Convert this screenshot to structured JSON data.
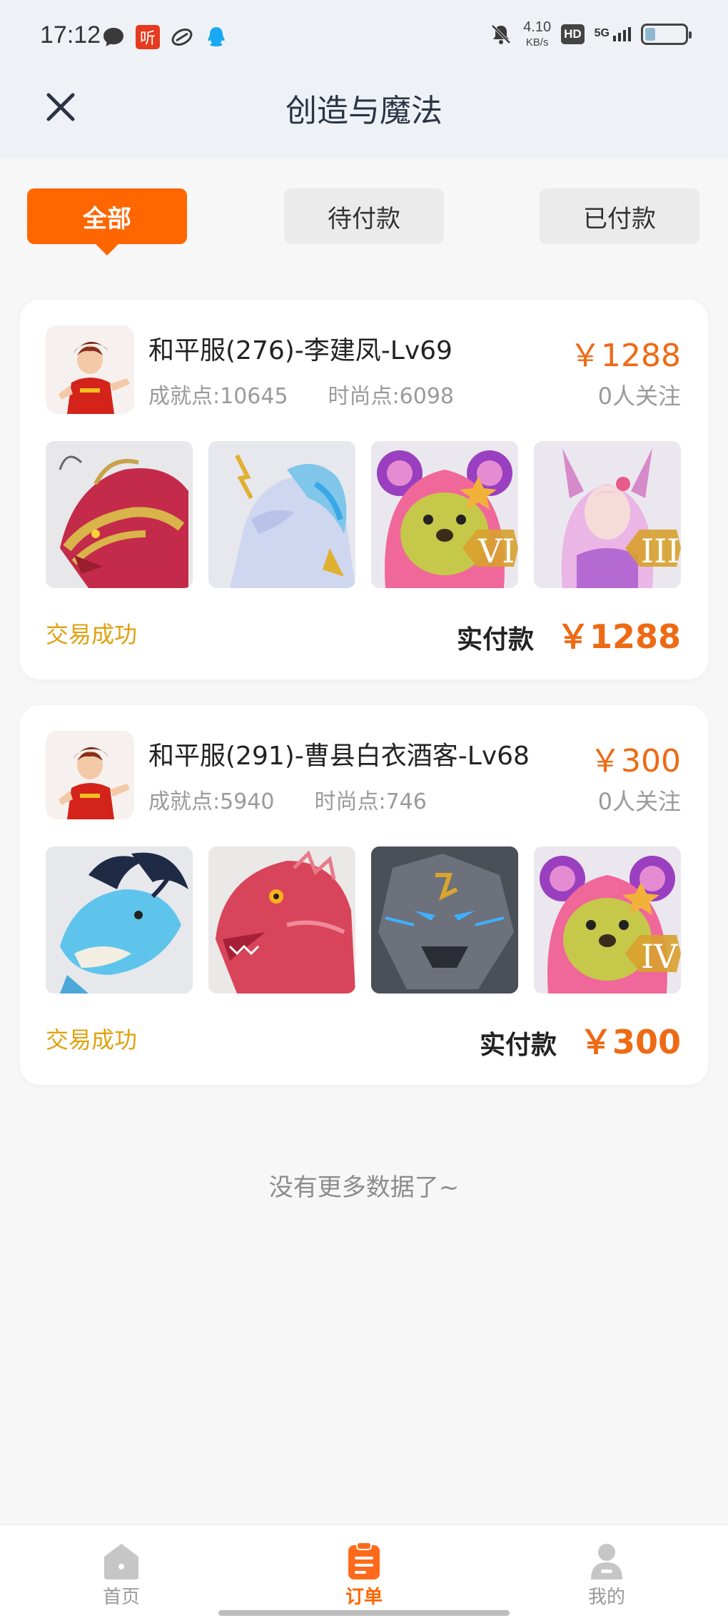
{
  "status_bar": {
    "time": "17:12",
    "ting_label": "听",
    "net_speed_value": "4.10",
    "net_speed_unit": "KB/s",
    "hd_label": "HD",
    "network_label": "5G",
    "battery_level": 0.25,
    "icons": [
      "message-icon",
      "ting-app-icon",
      "link-app-icon",
      "qq-icon",
      "mute-bell-icon",
      "hd-icon",
      "signal-icon",
      "battery-icon"
    ]
  },
  "header": {
    "title": "创造与魔法",
    "close_icon": "close-icon"
  },
  "tabs": [
    {
      "label": "全部",
      "active": true
    },
    {
      "label": "待付款",
      "active": false
    },
    {
      "label": "已付款",
      "active": false
    }
  ],
  "orders": [
    {
      "name": "和平服(276)-李建凤-Lv69",
      "achievement": "成就点:10645",
      "fashion": "时尚点:6098",
      "price": "￥1288",
      "followers": "0人关注",
      "items": [
        {
          "name": "red-golden-dragon-image",
          "badge": ""
        },
        {
          "name": "ice-blue-horse-image",
          "badge": ""
        },
        {
          "name": "pink-bear-image",
          "badge": "VI"
        },
        {
          "name": "fox-fairy-image",
          "badge": "III"
        }
      ],
      "status": "交易成功",
      "paid_label": "实付款",
      "paid_amount": "￥1288"
    },
    {
      "name": "和平服(291)-曹县白衣酒客-Lv68",
      "achievement": "成就点:5940",
      "fashion": "时尚点:746",
      "price": "￥300",
      "followers": "0人关注",
      "items": [
        {
          "name": "blue-dragon-image",
          "badge": ""
        },
        {
          "name": "red-scaled-dragon-image",
          "badge": ""
        },
        {
          "name": "stone-golem-image",
          "badge": ""
        },
        {
          "name": "pink-bear-image",
          "badge": "IV"
        }
      ],
      "status": "交易成功",
      "paid_label": "实付款",
      "paid_amount": "￥300"
    }
  ],
  "footer_note": "没有更多数据了~",
  "bottom_nav": [
    {
      "label": "首页",
      "icon": "home-icon",
      "active": false
    },
    {
      "label": "订单",
      "icon": "order-icon",
      "active": true
    },
    {
      "label": "我的",
      "icon": "profile-icon",
      "active": false
    }
  ],
  "colors": {
    "accent": "#ff6600",
    "price": "#ee6a14",
    "success": "#e0a10f"
  }
}
